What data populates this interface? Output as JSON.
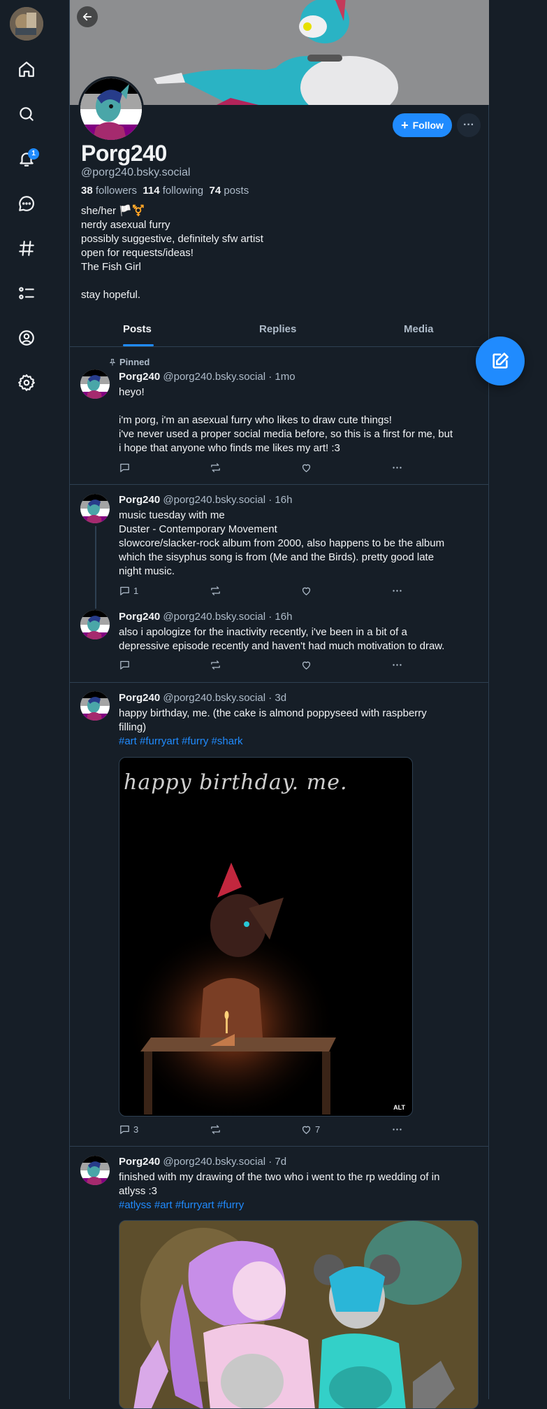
{
  "nav": {
    "items": [
      "home",
      "search",
      "notifications",
      "chat",
      "feeds",
      "lists",
      "profile",
      "settings"
    ],
    "notification_count": "1"
  },
  "profile": {
    "display_name": "Porg240",
    "handle": "@porg240.bsky.social",
    "followers_count": "38",
    "followers_label": "followers",
    "following_count": "114",
    "following_label": "following",
    "posts_count": "74",
    "posts_label": "posts",
    "bio_lines": [
      "she/her 🏳️⚧️",
      "nerdy asexual furry",
      "possibly suggestive, definitely sfw artist",
      "open for requests/ideas!",
      "The Fish Girl",
      "",
      "stay hopeful."
    ],
    "follow_label": "Follow",
    "more_label": "···"
  },
  "tabs": [
    "Posts",
    "Replies",
    "Media"
  ],
  "pinned_label": "Pinned",
  "posts": [
    {
      "name": "Porg240",
      "meta": "@porg240.bsky.social · 1mo",
      "text_lines": [
        "heyo!",
        "",
        "i'm porg, i'm an asexual furry who likes to draw cute things!",
        "i've never used a proper social media before, so this is a first for me, but",
        "i hope that anyone who finds me likes my art! :3"
      ],
      "replies": "",
      "reposts": "",
      "likes": ""
    },
    {
      "name": "Porg240",
      "meta": "@porg240.bsky.social · 16h",
      "text_lines": [
        "music tuesday with me",
        "Duster - Contemporary Movement",
        "slowcore/slacker-rock album from 2000, also happens to be the album",
        "which the sisyphus song is from (Me and the Birds). pretty good late",
        "night music."
      ],
      "replies": "1",
      "reposts": "",
      "likes": ""
    },
    {
      "name": "Porg240",
      "meta": "@porg240.bsky.social · 16h",
      "text_lines": [
        "also i apologize for the inactivity recently, i've been in a bit of a",
        "depressive episode recently and haven't had much motivation to draw."
      ],
      "replies": "",
      "reposts": "",
      "likes": ""
    },
    {
      "name": "Porg240",
      "meta": "@porg240.bsky.social · 3d",
      "text_lines": [
        "happy birthday, me. (the cake is almond poppyseed with raspberry",
        "filling)"
      ],
      "tags": "#art #furryart #furry #shark",
      "image_caption": "happy birthday. me.",
      "alt_label": "ALT",
      "replies": "3",
      "reposts": "",
      "likes": "7"
    },
    {
      "name": "Porg240",
      "meta": "@porg240.bsky.social · 7d",
      "text_lines": [
        "finished with my drawing of the two who i went to the rp wedding of in",
        "atlyss :3"
      ],
      "tags": "#atlyss #art #furryart #furry"
    }
  ]
}
